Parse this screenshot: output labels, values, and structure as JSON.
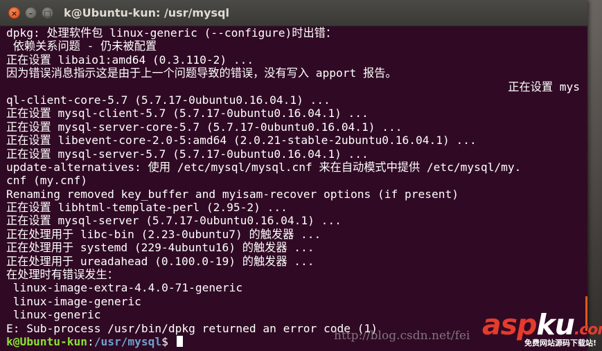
{
  "window": {
    "title": "k@Ubuntu-kun: /usr/mysql",
    "close_glyph": "×",
    "minimize_glyph": "–",
    "maximize_glyph": "□"
  },
  "terminal": {
    "lines": [
      "dpkg: 处理软件包 linux-generic (--configure)时出错：",
      " 依赖关系问题 - 仍未被配置",
      "正在设置 libaio1:amd64 (0.3.110-2) ...",
      "因为错误消息指示这是由于上一个问题导致的错误，没有写入 apport 报告。",
      "正在设置 mys",
      "ql-client-core-5.7 (5.7.17-0ubuntu0.16.04.1) ...",
      "正在设置 mysql-client-5.7 (5.7.17-0ubuntu0.16.04.1) ...",
      "正在设置 mysql-server-core-5.7 (5.7.17-0ubuntu0.16.04.1) ...",
      "正在设置 libevent-core-2.0-5:amd64 (2.0.21-stable-2ubuntu0.16.04.1) ...",
      "正在设置 mysql-server-5.7 (5.7.17-0ubuntu0.16.04.1) ...",
      "update-alternatives: 使用 /etc/mysql/mysql.cnf 来在自动模式中提供 /etc/mysql/my.",
      "cnf (my.cnf)",
      "Renaming removed key_buffer and myisam-recover options (if present)",
      "正在设置 libhtml-template-perl (2.95-2) ...",
      "正在设置 mysql-server (5.7.17-0ubuntu0.16.04.1) ...",
      "正在处理用于 libc-bin (2.23-0ubuntu7) 的触发器 ...",
      "正在处理用于 systemd (229-4ubuntu16) 的触发器 ...",
      "正在处理用于 ureadahead (0.100.0-19) 的触发器 ...",
      "在处理时有错误发生：",
      " linux-image-extra-4.4.0-71-generic",
      " linux-image-generic",
      " linux-generic",
      "E: Sub-process /usr/bin/dpkg returned an error code (1)"
    ],
    "prompt": {
      "user_host": "k@Ubuntu-kun",
      "separator": ":",
      "path": "/usr/mysql",
      "symbol": "$ "
    }
  },
  "watermark": {
    "url": "http://blog.csdn.net/fei",
    "logo_main": "asp",
    "logo_accent": "ku",
    "logo_suffix": ".com",
    "logo_tagline": "免费网站源码下载站!"
  },
  "colors": {
    "terminal_bg": "#300a24",
    "prompt_user": "#8ae234",
    "prompt_path": "#729fcf",
    "close_button": "#df4a16"
  }
}
